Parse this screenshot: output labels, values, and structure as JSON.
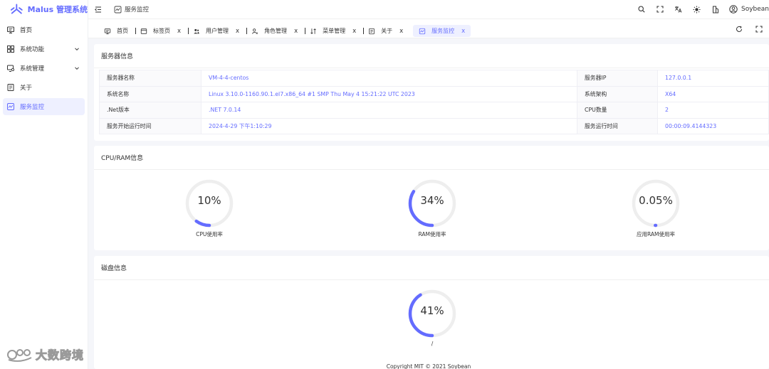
{
  "app": {
    "title": "Malus 管理系统",
    "brand_color": "#646cff"
  },
  "sidebar": {
    "items": [
      {
        "label": "首页",
        "icon": "monitor-icon",
        "expandable": false
      },
      {
        "label": "系统功能",
        "icon": "grid-icon",
        "expandable": true
      },
      {
        "label": "系统管理",
        "icon": "settings-screen-icon",
        "expandable": true
      },
      {
        "label": "关于",
        "icon": "document-icon",
        "expandable": false
      },
      {
        "label": "服务监控",
        "icon": "chart-icon",
        "expandable": false,
        "active": true
      }
    ]
  },
  "header": {
    "breadcrumb": "服务监控",
    "user_name": "Soybean",
    "icons": [
      "search-icon",
      "fullscreen-icon",
      "translate-icon",
      "sun-icon",
      "layout-icon",
      "user-icon"
    ]
  },
  "tabs": [
    {
      "label": "首页",
      "icon": "monitor-icon",
      "closable": false
    },
    {
      "label": "标签页",
      "icon": "tab-icon",
      "closable": true
    },
    {
      "label": "用户管理",
      "icon": "users-icon",
      "closable": true
    },
    {
      "label": "角色管理",
      "icon": "role-icon",
      "closable": true
    },
    {
      "label": "菜单管理",
      "icon": "menu-sort-icon",
      "closable": true
    },
    {
      "label": "关于",
      "icon": "document-icon",
      "closable": true
    },
    {
      "label": "服务监控",
      "icon": "chart-icon",
      "closable": true,
      "active": true
    }
  ],
  "tab_close_glyph": "x",
  "server_info": {
    "title": "服务器信息",
    "rows": [
      {
        "k1": "服务器名称",
        "v1": "VM-4-4-centos",
        "k2": "服务器IP",
        "v2": "127.0.0.1"
      },
      {
        "k1": "系统名称",
        "v1": "Linux 3.10.0-1160.90.1.el7.x86_64 #1 SMP Thu May 4 15:21:22 UTC 2023",
        "k2": "系统架构",
        "v2": "X64"
      },
      {
        "k1": ".Net版本",
        "v1": ".NET 7.0.14",
        "k2": "CPU数量",
        "v2": "2"
      },
      {
        "k1": "服务开始运行时间",
        "v1": "2024-4-29 下午1:10:29",
        "k2": "服务运行时间",
        "v2": "00:00:09.4144323"
      }
    ]
  },
  "cpu_ram": {
    "title": "CPU/RAM信息",
    "gauges": [
      {
        "label": "CPU使用率",
        "percent": 10,
        "display": "10%"
      },
      {
        "label": "RAM使用率",
        "percent": 34,
        "display": "34%"
      },
      {
        "label": "应用RAM使用率",
        "percent": 0.05,
        "display": "0.05%"
      }
    ]
  },
  "disk": {
    "title": "磁盘信息",
    "gauges": [
      {
        "label": "/",
        "percent": 41,
        "display": "41%"
      }
    ]
  },
  "footer": "Copyright MIT © 2021 Soybean",
  "watermark": "大数跨境"
}
